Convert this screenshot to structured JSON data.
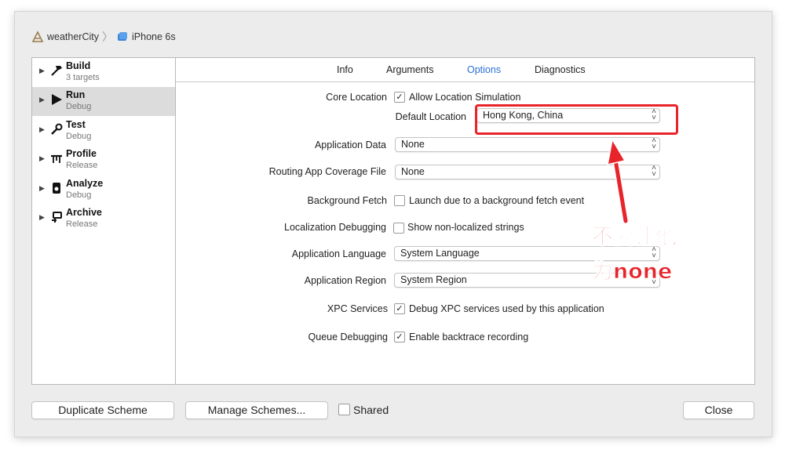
{
  "breadcrumb": {
    "project": "weatherCity",
    "device": "iPhone 6s"
  },
  "sidebar": {
    "items": [
      {
        "name": "Build",
        "sub": "3 targets",
        "icon": "hammer-icon"
      },
      {
        "name": "Run",
        "sub": "Debug",
        "icon": "play-icon"
      },
      {
        "name": "Test",
        "sub": "Debug",
        "icon": "wrench-icon"
      },
      {
        "name": "Profile",
        "sub": "Release",
        "icon": "instruments-icon"
      },
      {
        "name": "Analyze",
        "sub": "Debug",
        "icon": "analyze-icon"
      },
      {
        "name": "Archive",
        "sub": "Release",
        "icon": "archive-icon"
      }
    ],
    "selected": "Run"
  },
  "tabs": [
    "Info",
    "Arguments",
    "Options",
    "Diagnostics"
  ],
  "active_tab": "Options",
  "options": {
    "core_location": {
      "label": "Core Location",
      "checkbox": "Allow Location Simulation",
      "checked": true
    },
    "default_location": {
      "label": "Default Location",
      "value": "Hong Kong, China"
    },
    "application_data": {
      "label": "Application Data",
      "value": "None"
    },
    "routing": {
      "label": "Routing App Coverage File",
      "value": "None"
    },
    "background_fetch": {
      "label": "Background Fetch",
      "checkbox": "Launch due to a background fetch event",
      "checked": false
    },
    "localization": {
      "label": "Localization Debugging",
      "checkbox": "Show non-localized strings",
      "checked": false
    },
    "app_language": {
      "label": "Application Language",
      "value": "System Language"
    },
    "app_region": {
      "label": "Application Region",
      "value": "System Region"
    },
    "xpc": {
      "label": "XPC Services",
      "checkbox": "Debug XPC services used by this application",
      "checked": true
    },
    "queue": {
      "label": "Queue Debugging",
      "checkbox": "Enable backtrace recording",
      "checked": true
    }
  },
  "footer": {
    "duplicate": "Duplicate Scheme",
    "manage": "Manage Schemes...",
    "shared": "Shared",
    "shared_checked": false,
    "close": "Close"
  },
  "annotation": {
    "line1": "不要让他",
    "line2": "为none",
    "color": "#e8242b"
  },
  "colors": {
    "accent": "#2a6fd6",
    "selection": "#dcdcdc"
  }
}
